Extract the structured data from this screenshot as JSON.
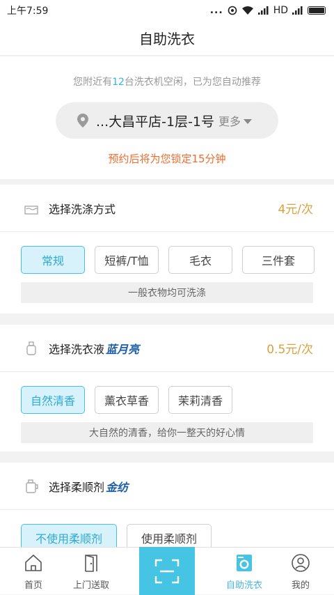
{
  "status": {
    "time": "上午7:59",
    "dots": "...",
    "network": "HD"
  },
  "nav": {
    "title": "自助洗衣"
  },
  "header": {
    "nearby_prefix": "您附近有",
    "nearby_count": "12",
    "nearby_suffix": "台洗衣机空闲，已为您自动推荐",
    "store_name": "...大昌平店-1层-1号",
    "more_label": "更多",
    "lock_note": "预约后将为您锁定15分钟"
  },
  "wash_mode": {
    "title": "选择洗涤方式",
    "price": "4元/次",
    "options": [
      "常规",
      "短裤/T恤",
      "毛衣",
      "三件套"
    ],
    "selected": 0,
    "description": "一般衣物均可洗涤"
  },
  "detergent": {
    "title": "选择洗衣液",
    "brand": "蓝月亮",
    "price": "0.5元/次",
    "options": [
      "自然清香",
      "薰衣草香",
      "茉莉清香"
    ],
    "selected": 0,
    "description": "大自然的清香，给你一整天的好心情"
  },
  "softener": {
    "title": "选择柔顺剂",
    "brand": "金纺",
    "options": [
      "不使用柔顺剂",
      "使用柔顺剂"
    ],
    "selected": 0
  },
  "tabbar": {
    "home": "首页",
    "pickup": "上门送取",
    "self_wash": "自助洗衣",
    "mine": "我的"
  },
  "colors": {
    "accent": "#46c4e4",
    "price": "#d9a13b",
    "warning": "#f26b2c"
  }
}
